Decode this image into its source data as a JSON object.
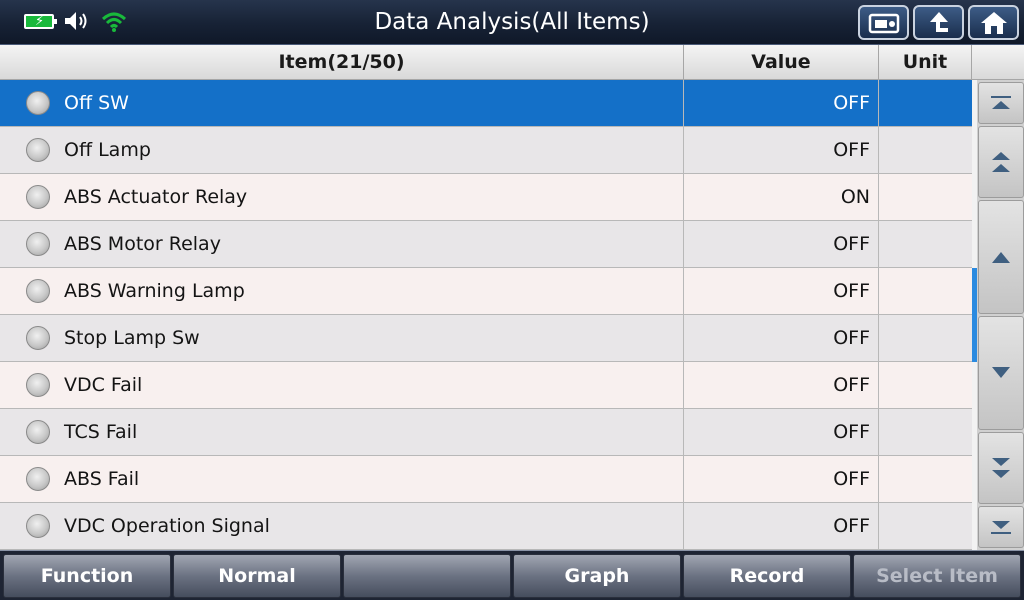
{
  "header": {
    "title": "Data Analysis(All Items)",
    "icons": [
      "battery-charging-icon",
      "speaker-icon",
      "wifi-icon"
    ],
    "buttons": [
      "screenshot-icon",
      "back-icon",
      "home-icon"
    ]
  },
  "table": {
    "columns": {
      "item": "Item(21/50)",
      "value": "Value",
      "unit": "Unit"
    },
    "rows": [
      {
        "item": "Off SW",
        "value": "OFF",
        "unit": ""
      },
      {
        "item": "Off Lamp",
        "value": "OFF",
        "unit": ""
      },
      {
        "item": "ABS Actuator Relay",
        "value": "ON",
        "unit": ""
      },
      {
        "item": "ABS Motor Relay",
        "value": "OFF",
        "unit": ""
      },
      {
        "item": "ABS Warning Lamp",
        "value": "OFF",
        "unit": ""
      },
      {
        "item": "Stop Lamp Sw",
        "value": "OFF",
        "unit": ""
      },
      {
        "item": "VDC Fail",
        "value": "OFF",
        "unit": ""
      },
      {
        "item": "TCS Fail",
        "value": "OFF",
        "unit": ""
      },
      {
        "item": "ABS Fail",
        "value": "OFF",
        "unit": ""
      },
      {
        "item": "VDC Operation Signal",
        "value": "OFF",
        "unit": ""
      }
    ],
    "selected_index": 0
  },
  "scrollbar": {
    "buttons": [
      "scroll-top-icon",
      "page-up-icon",
      "line-up-icon",
      "line-down-icon",
      "page-down-icon",
      "scroll-bottom-icon"
    ]
  },
  "footer": {
    "buttons": [
      {
        "label": "Function",
        "enabled": true
      },
      {
        "label": "Normal",
        "enabled": true
      },
      {
        "label": "",
        "enabled": true
      },
      {
        "label": "Graph",
        "enabled": true
      },
      {
        "label": "Record",
        "enabled": true
      },
      {
        "label": "Select Item",
        "enabled": false
      }
    ]
  },
  "colors": {
    "selected_row": "#1470c8",
    "scroll_thumb": "#2a8ae0",
    "battery": "#19b93b",
    "wifi": "#19b93b"
  }
}
